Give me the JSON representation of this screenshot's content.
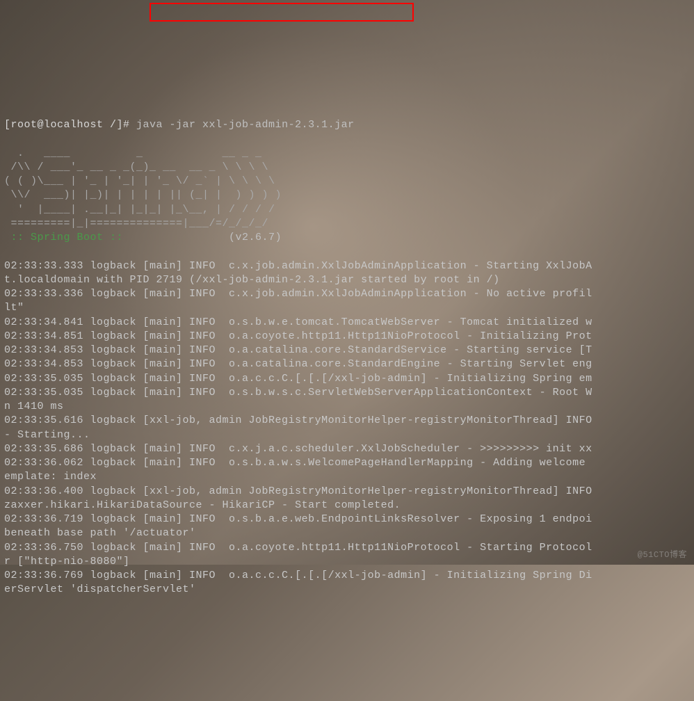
{
  "prompt": {
    "user_host": "[root@localhost /]# ",
    "command": "java -jar xxl-job-admin-2.3.1.jar"
  },
  "ascii_art": "  .   ____          _            __ _ _\n /\\\\ / ___'_ __ _ _(_)_ __  __ _ \\ \\ \\ \\\n( ( )\\___ | '_ | '_| | '_ \\/ _` | \\ \\ \\ \\\n \\\\/  ___)| |_)| | | | | || (_| |  ) ) ) )\n  '  |____| .__|_| |_|_| |_\\__, | / / / /\n =========|_|==============|___/=/_/_/_/",
  "spring_boot": {
    "label": " :: Spring Boot :: ",
    "version": "               (v2.6.7)"
  },
  "logs": [
    "02:33:33.333 logback [main] INFO  c.x.job.admin.XxlJobAdminApplication - Starting XxlJobA",
    "t.localdomain with PID 2719 (/xxl-job-admin-2.3.1.jar started by root in /)",
    "02:33:33.336 logback [main] INFO  c.x.job.admin.XxlJobAdminApplication - No active profil",
    "lt\"",
    "02:33:34.841 logback [main] INFO  o.s.b.w.e.tomcat.TomcatWebServer - Tomcat initialized w",
    "02:33:34.851 logback [main] INFO  o.a.coyote.http11.Http11NioProtocol - Initializing Prot",
    "02:33:34.853 logback [main] INFO  o.a.catalina.core.StandardService - Starting service [T",
    "02:33:34.853 logback [main] INFO  o.a.catalina.core.StandardEngine - Starting Servlet eng",
    "02:33:35.035 logback [main] INFO  o.a.c.c.C.[.[.[/xxl-job-admin] - Initializing Spring em",
    "02:33:35.035 logback [main] INFO  o.s.b.w.s.c.ServletWebServerApplicationContext - Root W",
    "n 1410 ms",
    "02:33:35.616 logback [xxl-job, admin JobRegistryMonitorHelper-registryMonitorThread] INFO",
    "- Starting...",
    "02:33:35.686 logback [main] INFO  c.x.j.a.c.scheduler.XxlJobScheduler - >>>>>>>>> init xx",
    "02:33:36.062 logback [main] INFO  o.s.b.a.w.s.WelcomePageHandlerMapping - Adding welcome ",
    "emplate: index",
    "02:33:36.400 logback [xxl-job, admin JobRegistryMonitorHelper-registryMonitorThread] INFO",
    "zaxxer.hikari.HikariDataSource - HikariCP - Start completed.",
    "02:33:36.719 logback [main] INFO  o.s.b.a.e.web.EndpointLinksResolver - Exposing 1 endpoi",
    "beneath base path '/actuator'",
    "02:33:36.750 logback [main] INFO  o.a.coyote.http11.Http11NioProtocol - Starting Protocol",
    "r [\"http-nio-8080\"]",
    "02:33:36.769 logback [main] INFO  o.a.c.c.C.[.[.[/xxl-job-admin] - Initializing Spring Di",
    "erServlet 'dispatcherServlet'"
  ],
  "watermark": "@51CTO博客"
}
